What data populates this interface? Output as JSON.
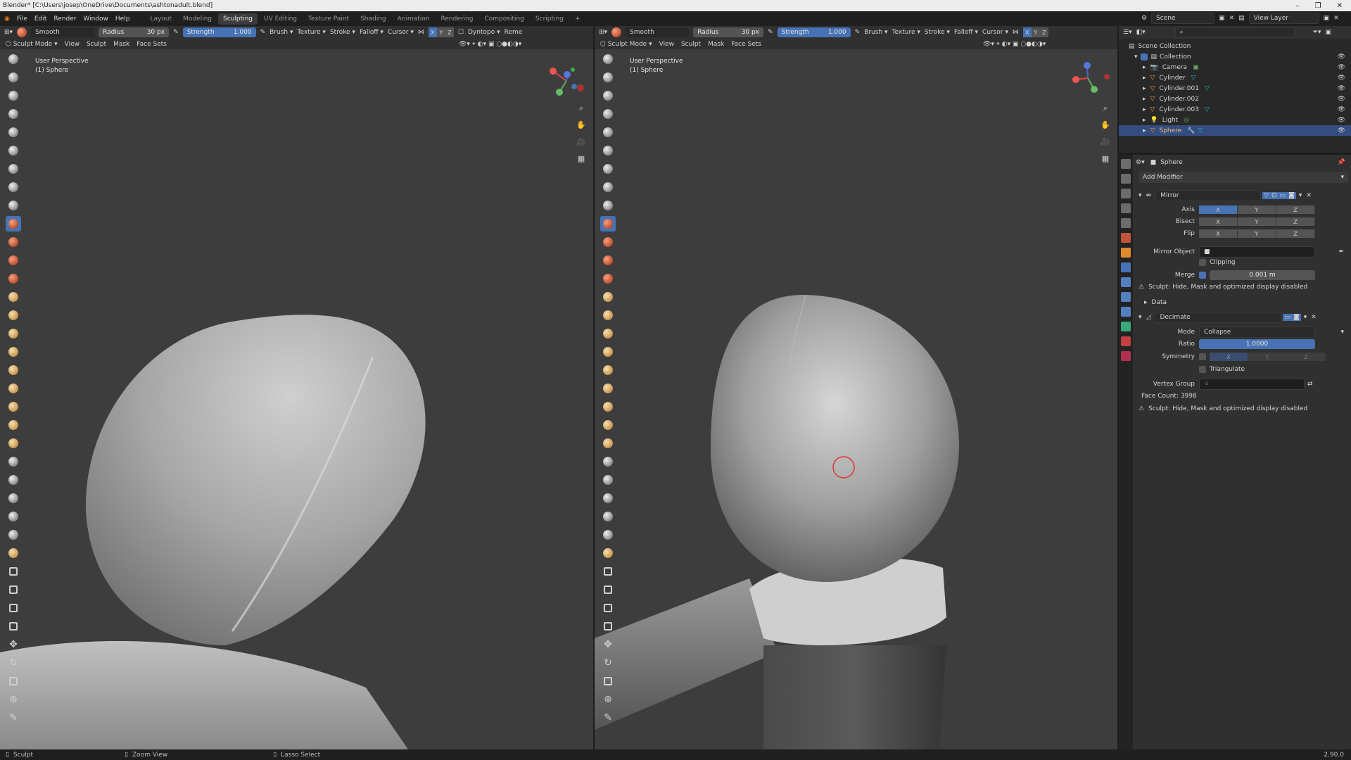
{
  "title": "Blender* [C:\\Users\\josep\\OneDrive\\Documents\\ashtonadult.blend]",
  "menu": [
    "File",
    "Edit",
    "Render",
    "Window",
    "Help"
  ],
  "workspaces": [
    "Layout",
    "Modeling",
    "Sculpting",
    "UV Editing",
    "Texture Paint",
    "Shading",
    "Animation",
    "Rendering",
    "Compositing",
    "Scripting"
  ],
  "active_workspace": "Sculpting",
  "scene": "Scene",
  "view_layer": "View Layer",
  "tool_header": {
    "brush": "Smooth",
    "radius_label": "Radius",
    "radius": "30 px",
    "strength_label": "Strength",
    "strength": "1.000",
    "menus": [
      "Brush",
      "Texture",
      "Stroke",
      "Falloff",
      "Cursor"
    ],
    "axes": [
      "X",
      "Y",
      "Z"
    ],
    "dyntopo": "Dyntopo",
    "remesh": "Reme"
  },
  "mode_header": {
    "mode": "Sculpt Mode",
    "items": [
      "View",
      "Sculpt",
      "Mask",
      "Face Sets"
    ]
  },
  "viewport_left": {
    "line1": "User Perspective",
    "line2": "(1) Sphere"
  },
  "viewport_right": {
    "line1": "User Perspective",
    "line2": "(1) Sphere"
  },
  "outliner": {
    "root": "Scene Collection",
    "collection": "Collection",
    "items": [
      "Camera",
      "Cylinder",
      "Cylinder.001",
      "Cylinder.002",
      "Cylinder.003",
      "Light",
      "Sphere"
    ],
    "selected": "Sphere"
  },
  "properties": {
    "object": "Sphere",
    "add_modifier": "Add Modifier",
    "mirror": {
      "name": "Mirror",
      "axis_label": "Axis",
      "bisect_label": "Bisect",
      "flip_label": "Flip",
      "axes": [
        "X",
        "Y",
        "Z"
      ],
      "mirror_object_label": "Mirror Object",
      "clipping": "Clipping",
      "merge_label": "Merge",
      "merge_value": "0.001 m",
      "warning": "Sculpt: Hide, Mask and optimized display disabled",
      "data": "Data"
    },
    "decimate": {
      "name": "Decimate",
      "mode_label": "Mode",
      "mode": "Collapse",
      "ratio_label": "Ratio",
      "ratio": "1.0000",
      "symmetry_label": "Symmetry",
      "triangulate": "Triangulate",
      "vertex_group_label": "Vertex Group",
      "face_count": "Face Count: 3998",
      "warning": "Sculpt: Hide, Mask and optimized display disabled"
    }
  },
  "status": {
    "left": "Sculpt",
    "mid": "Zoom View",
    "lasso": "Lasso Select",
    "version": "2.90.0"
  },
  "colors": {
    "accent": "#4772b3",
    "viewport_bg": "#3d3d3d",
    "selected_row": "#334d80"
  }
}
